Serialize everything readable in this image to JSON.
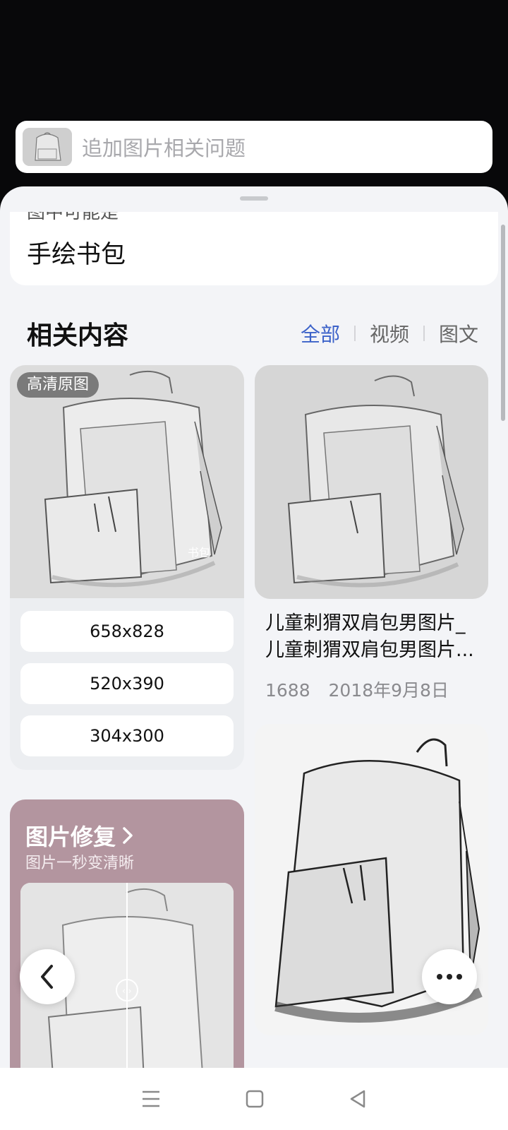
{
  "search": {
    "placeholder": "追加图片相关问题",
    "thumb_icon": "backpack-sketch-thumbnail"
  },
  "result": {
    "peek_text": "图中可能是",
    "answer": "手绘书包"
  },
  "related": {
    "title": "相关内容",
    "tabs": [
      {
        "label": "全部",
        "active": true
      },
      {
        "label": "视频",
        "active": false
      },
      {
        "label": "图文",
        "active": false
      }
    ]
  },
  "cards": {
    "first": {
      "badge": "高清原图",
      "watermark": "书包",
      "sizes": [
        "658x828",
        "520x390",
        "304x300"
      ]
    },
    "second": {
      "caption_line1": "儿童刺猬双肩包男图片_",
      "caption_line2": "儿童刺猬双肩包男图片...",
      "source": "1688",
      "date": "2018年9月8日"
    },
    "repair": {
      "title": "图片修复",
      "subtitle": "图片一秒变清晰"
    }
  },
  "colors": {
    "accent": "#3c62c9",
    "repair_bg": "#b3959f",
    "sheet_bg": "#f3f4f7"
  },
  "icons": {
    "back": "chevron-left-icon",
    "more": "more-dots-icon",
    "nav_menu": "menu-icon",
    "nav_home": "home-square-icon",
    "nav_back": "back-triangle-icon"
  }
}
